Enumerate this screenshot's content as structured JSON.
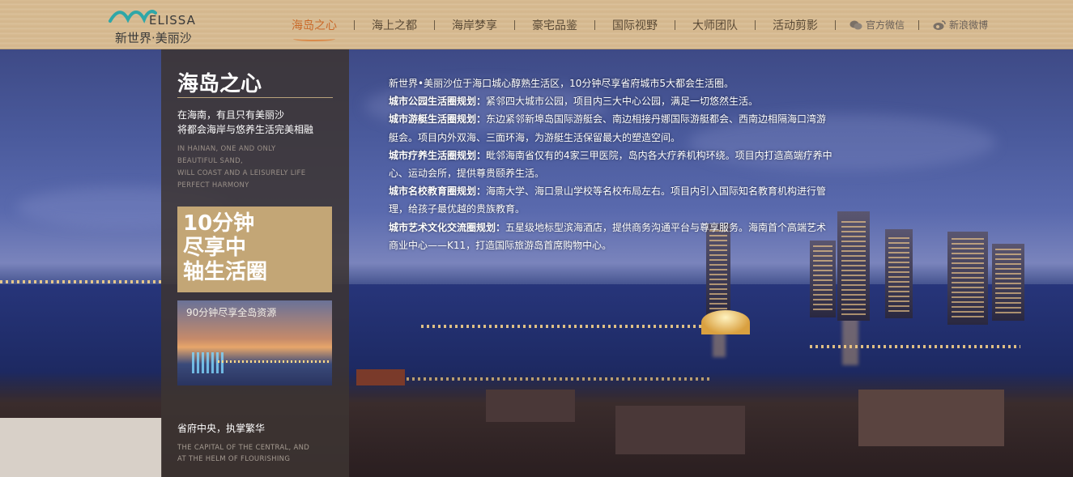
{
  "logo": {
    "brand_en": "ELISSA",
    "brand_cn": "新世界·美丽沙"
  },
  "nav": {
    "items": [
      {
        "label": "海岛之心",
        "active": true
      },
      {
        "label": "海上之都",
        "active": false
      },
      {
        "label": "海岸梦享",
        "active": false
      },
      {
        "label": "豪宅品鉴",
        "active": false
      },
      {
        "label": "国际视野",
        "active": false
      },
      {
        "label": "大师团队",
        "active": false
      },
      {
        "label": "活动剪影",
        "active": false
      }
    ],
    "social": [
      {
        "label": "官方微信",
        "icon": "wechat-icon"
      },
      {
        "label": "新浪微博",
        "icon": "weibo-icon"
      }
    ]
  },
  "panel": {
    "title": "海岛之心",
    "subtitle_1": "在海南，有且只有美丽沙",
    "subtitle_2": "将都会海岸与悠养生活完美相融",
    "en_1": "IN HAINAN, ONE AND ONLY",
    "en_2": "BEAUTIFUL SAND,",
    "en_3": "WILL COAST AND A LEISURELY LIFE",
    "en_4": "PERFECT HARMONY",
    "promo_1": "10分钟",
    "promo_2": "尽享中",
    "promo_3": "轴生活圈",
    "thumb_label": "90分钟尽享全岛资源",
    "footer": "省府中央，执掌繁华",
    "footer_en_1": "THE CAPITAL OF THE CENTRAL, AND",
    "footer_en_2": "AT THE HELM OF FLOURISHING"
  },
  "content": {
    "intro": "新世界•美丽沙位于海口城心醇熟生活区，10分钟尽享省府城市5大都会生活圈。",
    "sections": [
      {
        "heading": "城市公园生活圈规划：",
        "text": "紧邻四大城市公园，项目内三大中心公园，满足一切悠然生活。"
      },
      {
        "heading": "城市游艇生活圈规划：",
        "text": "东边紧邻新埠岛国际游艇会、南边相接丹娜国际游艇都会、西南边相隔海口湾游艇会。项目内外双海、三面环海，为游艇生活保留最大的塑造空间。"
      },
      {
        "heading": "城市疗养生活圈规划：",
        "text": "毗邻海南省仅有的4家三甲医院，岛内各大疗养机构环绕。项目内打造高端疗养中心、运动会所，提供尊贵颐养生活。"
      },
      {
        "heading": "城市名校教育圈规划：",
        "text": "海南大学、海口景山学校等名校布局左右。项目内引入国际知名教育机构进行管理，给孩子最优越的贵族教育。"
      },
      {
        "heading": "城市艺术文化交流圈规划：",
        "text": "五星级地标型滨海酒店，提供商务沟通平台与尊享服务。海南首个高端艺术商业中心——K11，打造国际旅游岛首席购物中心。"
      }
    ]
  },
  "colors": {
    "accent": "#c96a2a",
    "header_bg": "#d8bc93",
    "promo_bg": "#c3a676"
  }
}
